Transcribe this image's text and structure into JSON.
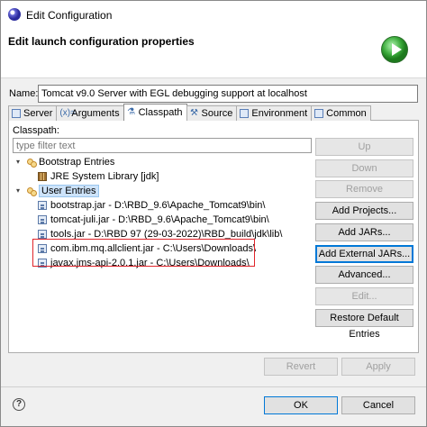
{
  "window": {
    "title": "Edit Configuration"
  },
  "header": {
    "title": "Edit launch configuration properties",
    "run_icon": "run-icon"
  },
  "name": {
    "label": "Name:",
    "value": "Tomcat v9.0 Server with EGL debugging support at localhost"
  },
  "tabs": [
    {
      "label": "Server",
      "icon": "server-icon",
      "active": false
    },
    {
      "label": "Arguments",
      "icon": "arguments-icon",
      "active": false
    },
    {
      "label": "Classpath",
      "icon": "classpath-icon",
      "active": true
    },
    {
      "label": "Source",
      "icon": "source-icon",
      "active": false
    },
    {
      "label": "Environment",
      "icon": "environment-icon",
      "active": false
    },
    {
      "label": "Common",
      "icon": "common-icon",
      "active": false
    }
  ],
  "classpath": {
    "label": "Classpath:",
    "filter_placeholder": "type filter text",
    "tree": {
      "bootstrap": {
        "label": "Bootstrap Entries",
        "children": [
          "JRE System Library [jdk]"
        ]
      },
      "user": {
        "label": "User Entries",
        "children": [
          "bootstrap.jar - D:\\RBD_9.6\\Apache_Tomcat9\\bin\\",
          "tomcat-juli.jar - D:\\RBD_9.6\\Apache_Tomcat9\\bin\\",
          "tools.jar - D:\\RBD 97 (29-03-2022)\\RBD_build\\jdk\\lib\\",
          "com.ibm.mq.allclient.jar - C:\\Users\\Downloads\\",
          "javax.jms-api-2.0.1.jar - C:\\Users\\Downloads\\"
        ]
      }
    }
  },
  "side_buttons": {
    "up": "Up",
    "down": "Down",
    "remove": "Remove",
    "add_projects": "Add Projects...",
    "add_jars": "Add JARs...",
    "add_external_jars": "Add External JARs...",
    "advanced": "Advanced...",
    "edit": "Edit...",
    "restore": "Restore Default Entries"
  },
  "footer": {
    "revert": "Revert",
    "apply": "Apply",
    "ok": "OK",
    "cancel": "Cancel",
    "help_icon": "help-icon"
  },
  "colors": {
    "highlight_border": "#e0242a",
    "focus_blue": "#0078d7"
  }
}
